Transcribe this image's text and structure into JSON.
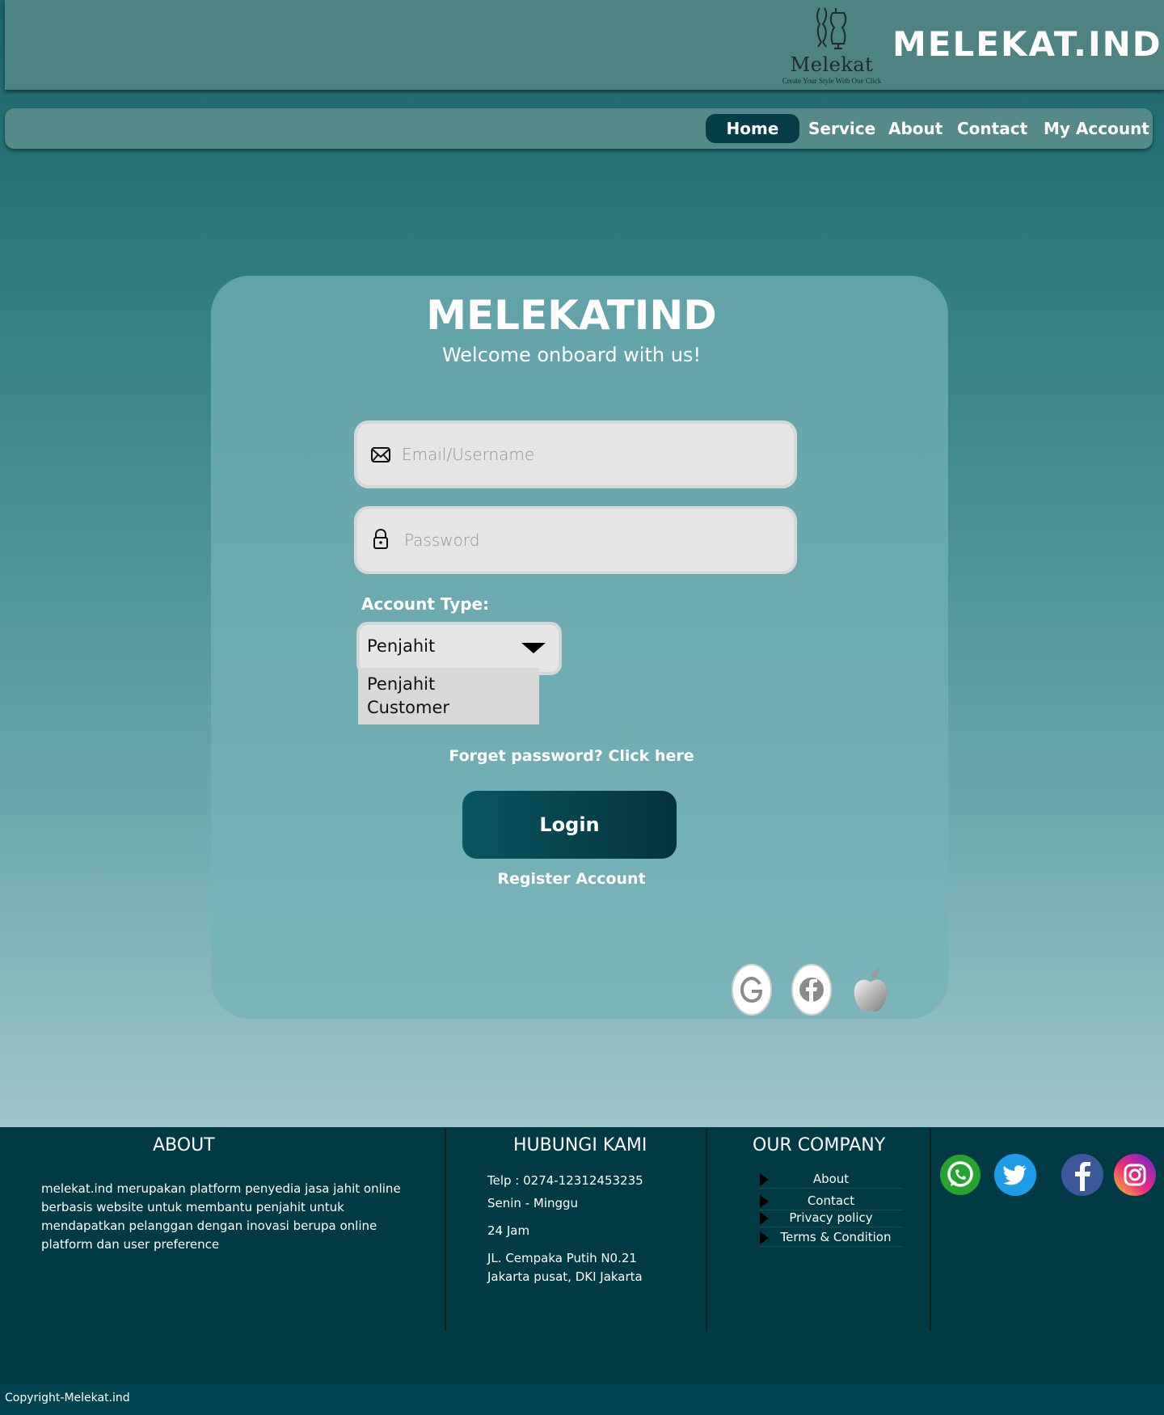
{
  "header": {
    "logo_name": "Melekat",
    "logo_tagline": "Create Your Style With One Click",
    "brand": "MELEKAT.IND"
  },
  "nav": {
    "items": [
      {
        "label": "Home",
        "active": true
      },
      {
        "label": "Service"
      },
      {
        "label": "About"
      },
      {
        "label": "Contact"
      },
      {
        "label": "My Account"
      }
    ]
  },
  "login": {
    "title": "MELEKATIND",
    "subtitle": "Welcome onboard with us!",
    "email_placeholder": "Email/Username",
    "password_placeholder": "Password",
    "account_type_label": "Account Type:",
    "account_type_selected": "Penjahit",
    "account_type_options": [
      "Penjahit",
      "Customer"
    ],
    "forget_password": "Forget password? Click here",
    "login_button": "Login",
    "register": "Register Account",
    "social_logins": [
      "google-icon",
      "facebook-icon",
      "apple-icon"
    ]
  },
  "footer": {
    "about_title": "ABOUT",
    "about_text": "melekat.ind merupakan platform penyedia jasa jahit online berbasis website untuk membantu penjahit untuk mendapatkan pelanggan dengan inovasi berupa online platform dan user preference",
    "contact_title": "HUBUNGI KAMI",
    "phone": "Telp  :  0274-12312453235",
    "days": "Senin - Minggu",
    "hours": "24 Jam",
    "address_line1": "JL. Cempaka Putih N0.21",
    "address_line2": "Jakarta pusat, DKI Jakarta",
    "company_title": "OUR COMPANY",
    "company_links": [
      "About",
      "Contact",
      "Privacy policy",
      "Terms & Condition"
    ],
    "social_icons": [
      "whatsapp-icon",
      "twitter-icon",
      "facebook-icon",
      "instagram-icon"
    ],
    "copyright": "Copyright-Melekat.ind"
  },
  "colors": {
    "header_bg": "#4e8383",
    "nav_active": "#053e48",
    "footer_bg": "#003a45",
    "button": "#03323e"
  }
}
